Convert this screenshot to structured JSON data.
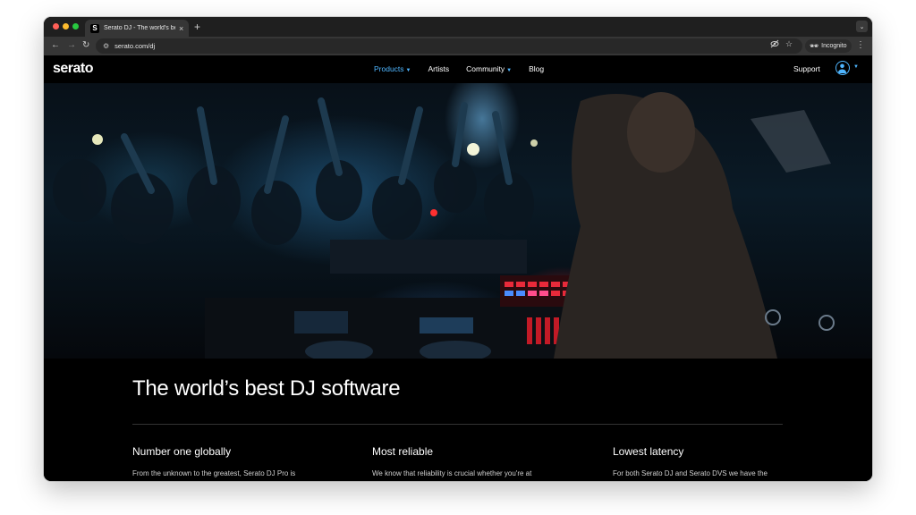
{
  "browser": {
    "tab_title": "Serato DJ - The world's best",
    "tab_favicon": "S",
    "tab_close": "×",
    "new_tab": "+",
    "url": "serato.com/dj",
    "incognito_label": "Incognito"
  },
  "site": {
    "logo": "serato",
    "nav": {
      "products": "Products",
      "artists": "Artists",
      "community": "Community",
      "blog": "Blog",
      "support": "Support"
    },
    "accent_color": "#4fb6ff",
    "headline": "The world’s best DJ software",
    "features": [
      {
        "title": "Number one globally",
        "text": "From the unknown to the greatest, Serato DJ Pro is"
      },
      {
        "title": "Most reliable",
        "text": "We know that reliability is crucial whether you're at"
      },
      {
        "title": "Lowest latency",
        "text": "For both Serato DJ and Serato DVS we have the"
      }
    ]
  },
  "icons": {
    "back": "back-arrow-icon",
    "forward": "forward-arrow-icon",
    "reload": "reload-icon",
    "eye_off": "eye-off-icon",
    "star": "star-icon",
    "account": "account-icon"
  }
}
